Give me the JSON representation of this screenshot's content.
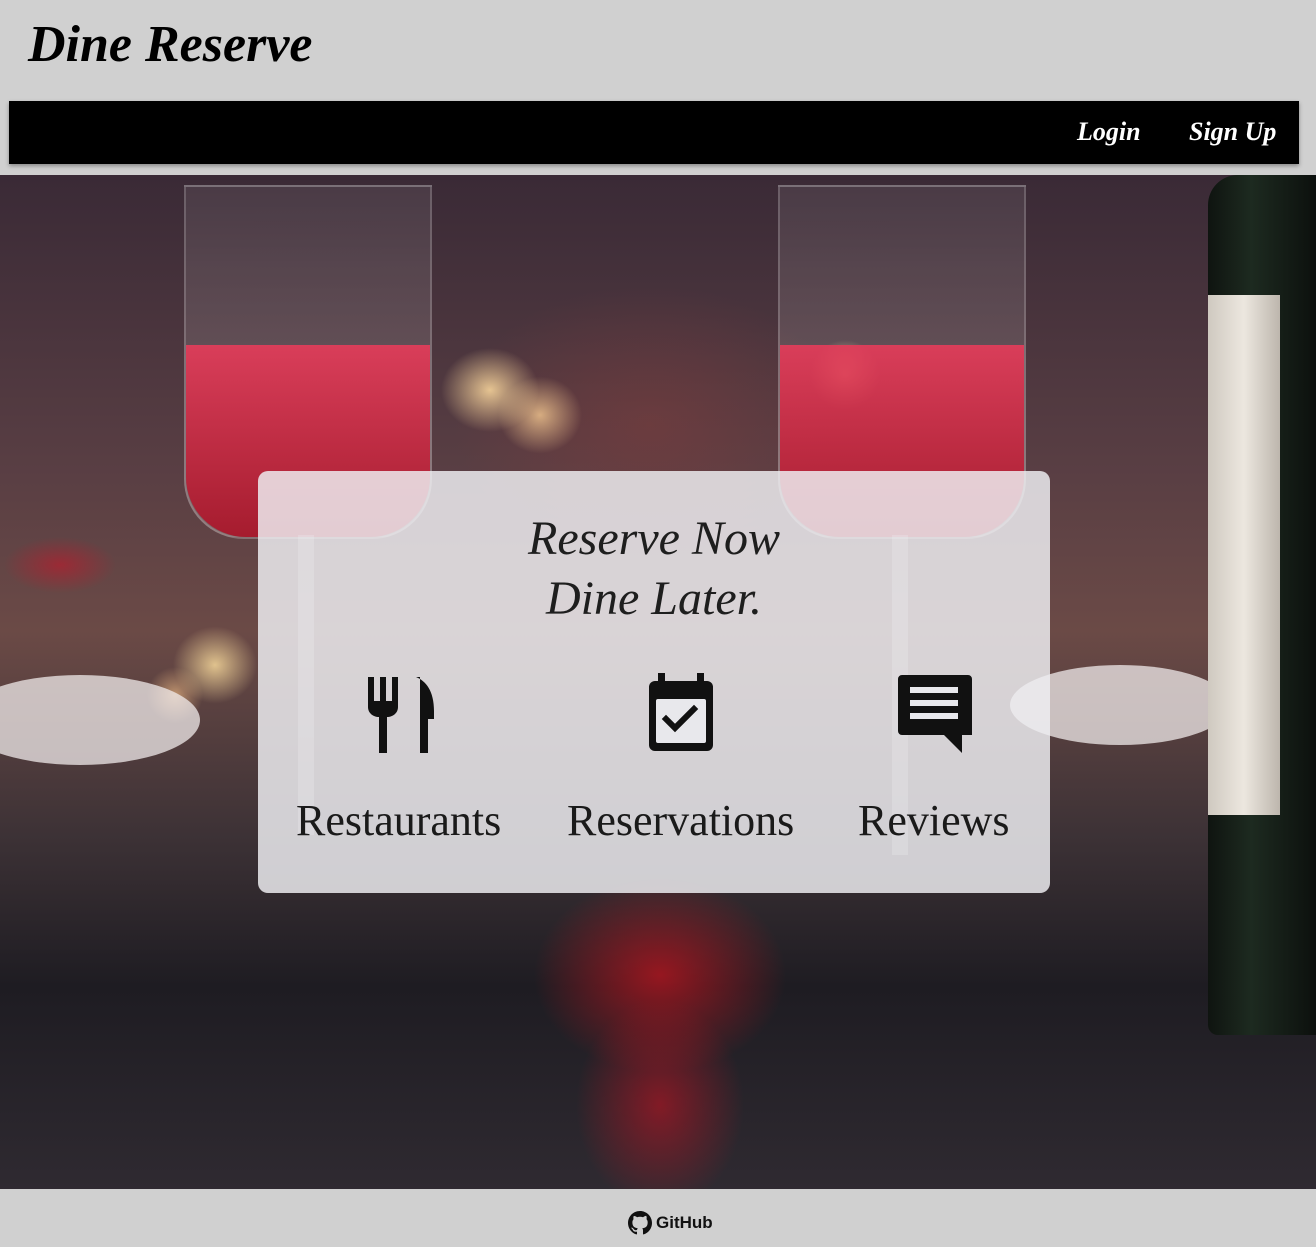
{
  "header": {
    "brand": "Dine Reserve"
  },
  "nav": {
    "login": "Login",
    "signup": "Sign Up"
  },
  "hero": {
    "tagline_line1": "Reserve Now",
    "tagline_line2": "Dine Later.",
    "features": [
      {
        "label": "Restaurants",
        "icon": "fork-knife-icon"
      },
      {
        "label": "Reservations",
        "icon": "calendar-check-icon"
      },
      {
        "label": "Reviews",
        "icon": "review-comment-icon"
      }
    ]
  },
  "footer": {
    "github_label": "GitHub",
    "icon": "github-icon"
  },
  "colors": {
    "header_bg": "#d0d0d0",
    "navbar_bg": "#000000",
    "nav_text": "#ffffff",
    "card_bg": "#eeeef2"
  }
}
